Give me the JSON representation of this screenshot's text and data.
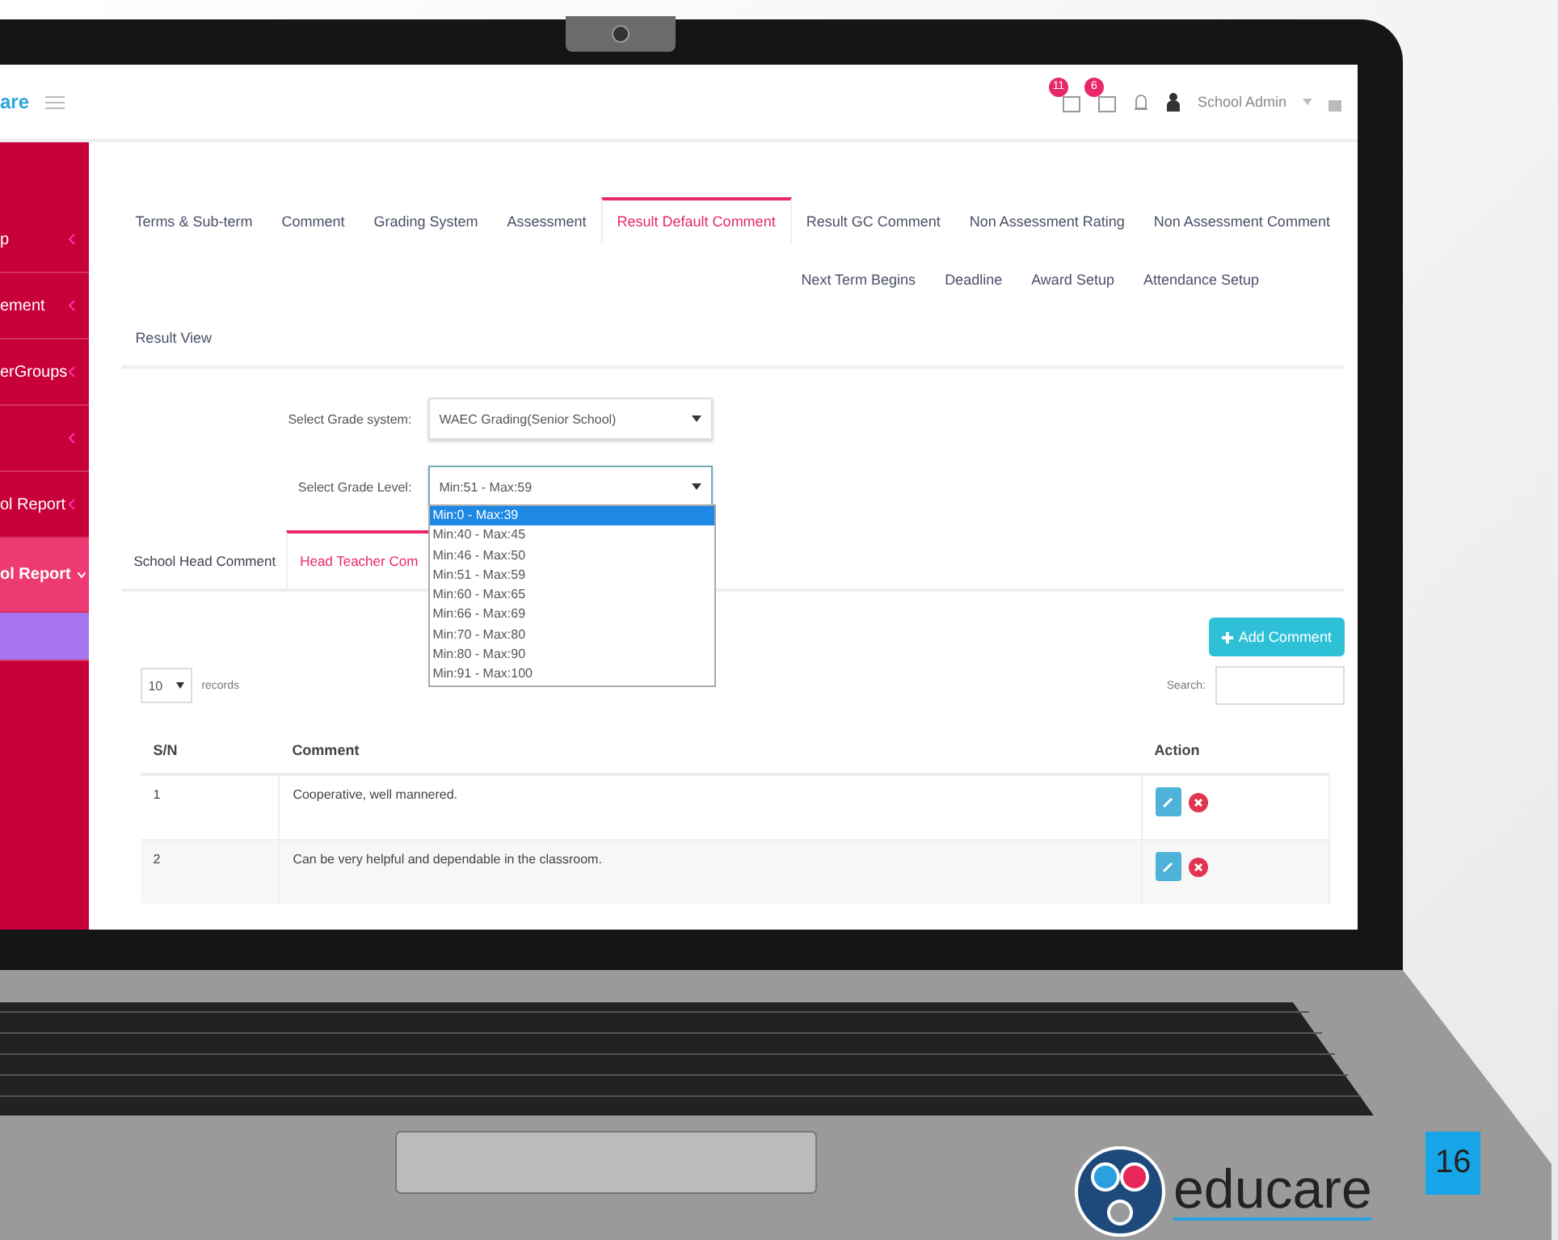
{
  "header": {
    "logo_text": "are",
    "notifications": [
      {
        "count": "11"
      },
      {
        "count": "6"
      }
    ],
    "user": "School Admin"
  },
  "sidebar": {
    "items": [
      {
        "label": "p",
        "selected": false,
        "kind": "link"
      },
      {
        "label": "ement",
        "selected": false,
        "kind": "link"
      },
      {
        "label": "erGroups",
        "selected": false,
        "kind": "link"
      },
      {
        "selected": false,
        "kind": "link"
      },
      {
        "label": "ol Report",
        "selected": false,
        "kind": "link"
      },
      {
        "label": "ol Report",
        "selected": true,
        "kind": "link"
      },
      {
        "kind": "accent"
      }
    ]
  },
  "tab_rows": [
    [
      {
        "label": "Terms & Sub-term",
        "selected": false
      },
      {
        "label": "Comment",
        "selected": false
      },
      {
        "label": "Grading System",
        "selected": false
      },
      {
        "label": "Assessment",
        "selected": false
      },
      {
        "label": "Result Default Comment",
        "selected": true
      },
      {
        "label": "Result GC Comment",
        "selected": false
      },
      {
        "label": "Non Assessment Rating",
        "selected": false
      },
      {
        "label": "Non Assessment Comment",
        "selected": false
      }
    ],
    [
      {
        "label": "Next Term Begins",
        "selected": false
      },
      {
        "label": "Deadline",
        "selected": false
      },
      {
        "label": "Award Setup",
        "selected": false
      },
      {
        "label": "Attendance Setup",
        "selected": false
      }
    ],
    [
      {
        "label": "Result View",
        "selected": false
      }
    ]
  ],
  "form": {
    "grade_system": {
      "label": "Select Grade system:",
      "value": "WAEC Grading(Senior School)"
    },
    "grade_level": {
      "label": "Select Grade Level:",
      "value": "Min:51 - Max:59",
      "expanded": true,
      "options": [
        {
          "label": "Min:0 - Max:39",
          "highlighted": true
        },
        {
          "label": "Min:40 - Max:45",
          "highlighted": false
        },
        {
          "label": "Min:46 - Max:50",
          "highlighted": false
        },
        {
          "label": "Min:51 - Max:59",
          "highlighted": false
        },
        {
          "label": "Min:60 - Max:65",
          "highlighted": false
        },
        {
          "label": "Min:66 - Max:69",
          "highlighted": false
        },
        {
          "label": "Min:70 - Max:80",
          "highlighted": false
        },
        {
          "label": "Min:80 - Max:90",
          "highlighted": false
        },
        {
          "label": "Min:91 - Max:100",
          "highlighted": false
        }
      ]
    }
  },
  "sub_tabs": [
    {
      "label": "School Head Comment",
      "selected": false
    },
    {
      "label": "Head Teacher Com",
      "selected": true
    }
  ],
  "add_button": "Add Comment",
  "page_size": {
    "value": "10",
    "label": "records"
  },
  "search": {
    "label": "Search:"
  },
  "table": {
    "columns": [
      "S/N",
      "Comment",
      "Action"
    ],
    "rows": [
      {
        "sn": "1",
        "comment": "Cooperative, well mannered."
      },
      {
        "sn": "2",
        "comment": "Can be very helpful and dependable in the classroom."
      }
    ]
  },
  "slide": {
    "brand": "educare",
    "page_number": "16"
  }
}
